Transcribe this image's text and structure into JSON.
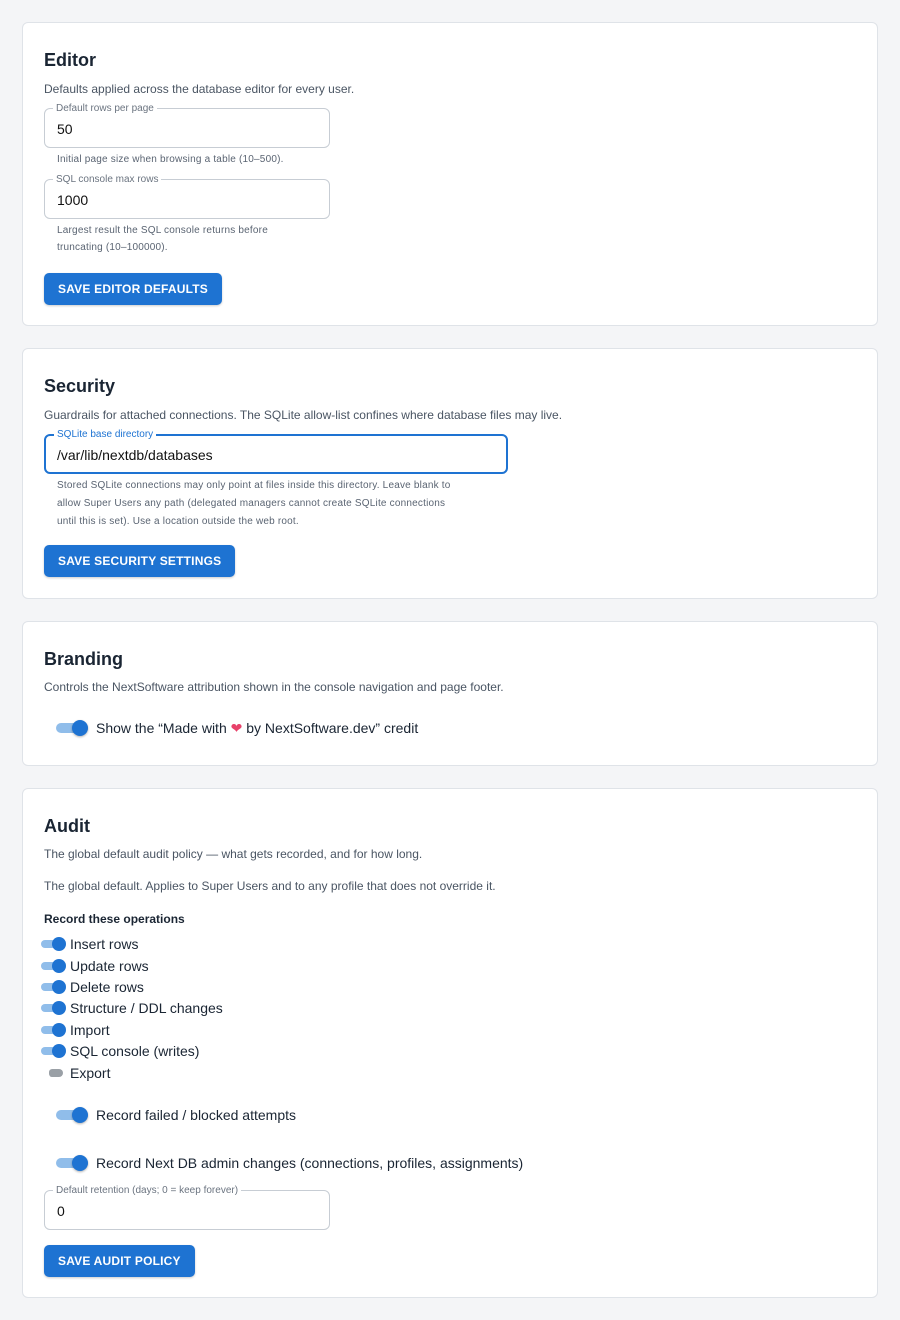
{
  "editor": {
    "title": "Editor",
    "description": "Defaults applied across the database editor for every user.",
    "rows_per_page": {
      "label": "Default rows per page",
      "value": "50",
      "hint": "Initial page size when browsing a table (10–500)."
    },
    "sql_max_rows": {
      "label": "SQL console max rows",
      "value": "1000",
      "hint_line1": "Largest result the SQL console returns before",
      "hint_line2": "truncating (10–100000)."
    },
    "save_label": "SAVE EDITOR DEFAULTS"
  },
  "security": {
    "title": "Security",
    "description": "Guardrails for attached connections. The SQLite allow-list confines where database files may live.",
    "sqlite_dir": {
      "label": "SQLite base directory",
      "value": "/var/lib/nextdb/databases"
    },
    "hint_line1": "Stored SQLite connections may only point at files inside this directory. Leave blank to",
    "hint_line2": "allow Super Users any path (delegated managers cannot create SQLite connections",
    "hint_line3": "until this is set). Use a location outside the web root.",
    "save_label": "SAVE SECURITY SETTINGS"
  },
  "branding": {
    "title": "Branding",
    "description": "Controls the NextSoftware attribution shown in the console navigation and page footer.",
    "credit_prefix": "Show the “Made with ",
    "credit_heart": "❤",
    "credit_suffix": " by NextSoftware.dev” credit",
    "credit_enabled": true
  },
  "audit": {
    "title": "Audit",
    "description": "The global default audit policy — what gets recorded, and for how long.",
    "note": "The global default. Applies to Super Users and to any profile that does not override it.",
    "ops_heading": "Record these operations",
    "operations": [
      {
        "label": "Insert rows",
        "enabled": true
      },
      {
        "label": "Update rows",
        "enabled": true
      },
      {
        "label": "Delete rows",
        "enabled": true
      },
      {
        "label": "Structure / DDL changes",
        "enabled": true
      },
      {
        "label": "Import",
        "enabled": true
      },
      {
        "label": "SQL console (writes)",
        "enabled": true
      },
      {
        "label": "Export",
        "enabled": false
      }
    ],
    "failed_label": "Record failed / blocked attempts",
    "failed_enabled": true,
    "admin_label": "Record Next DB admin changes (connections, profiles, assignments)",
    "admin_enabled": true,
    "retention": {
      "label": "Default retention (days; 0 = keep forever)",
      "value": "0"
    },
    "save_label": "SAVE AUDIT POLICY"
  },
  "colors": {
    "accent": "#1e73d2",
    "accent_light": "#90bdea",
    "heart": "#e8426a",
    "background": "#f4f5f7"
  }
}
